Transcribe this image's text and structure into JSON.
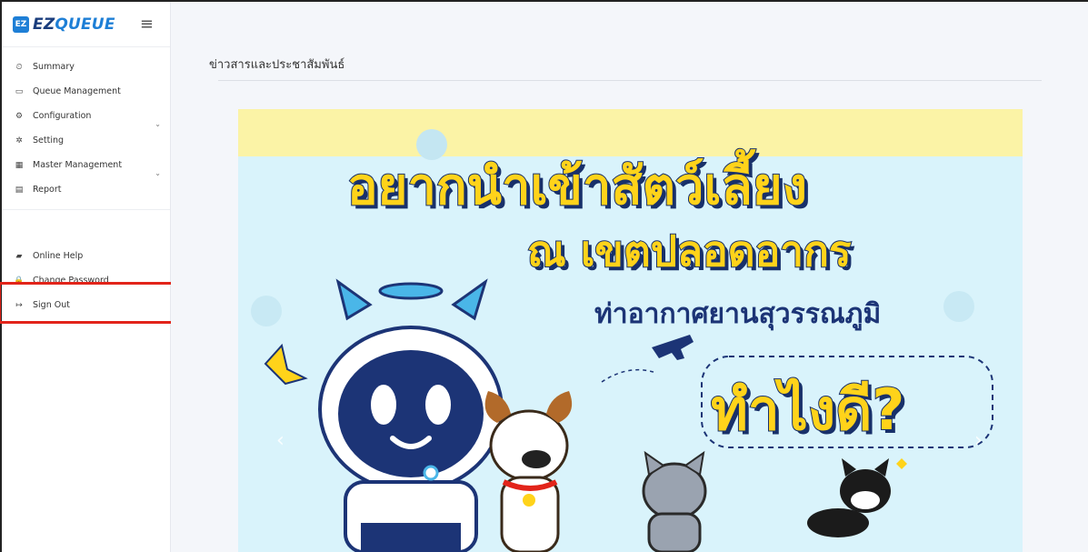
{
  "brand": {
    "logo": "EZ",
    "name_part1": "EZ",
    "name_part2": "QUEUE"
  },
  "sidebar": {
    "items": [
      {
        "label": "Summary",
        "icon": "dashboard-icon",
        "glyph": "⏲"
      },
      {
        "label": "Queue Management",
        "icon": "inbox-icon",
        "glyph": "▭"
      },
      {
        "label": "Configuration",
        "icon": "gears-icon",
        "glyph": "⚙",
        "has_submenu": true
      },
      {
        "label": "Setting",
        "icon": "gear-icon",
        "glyph": "✲"
      },
      {
        "label": "Master Management",
        "icon": "table-icon",
        "glyph": "▦",
        "has_submenu": true
      },
      {
        "label": "Report",
        "icon": "file-icon",
        "glyph": "▤"
      }
    ],
    "bottom_items": [
      {
        "label": "Online Help",
        "icon": "book-icon",
        "glyph": "▰"
      },
      {
        "label": "Change Password",
        "icon": "lock-icon",
        "glyph": "🔒"
      },
      {
        "label": "Sign Out",
        "icon": "sign-out-icon",
        "glyph": "↦"
      }
    ]
  },
  "main": {
    "page_title": "ข่าวสารและประชาสัมพันธ์",
    "banner": {
      "line1": "อยากนำเข้าสัตว์เลี้ยง",
      "line2": "ณ เขตปลอดอากร",
      "line3": "ท่าอากาศยานสุวรรณภูมิ",
      "line4": "ทำไงดี?"
    }
  },
  "colors": {
    "accent": "#1e7fd6",
    "brand_dark": "#1a3d7c",
    "highlight": "#e2241a",
    "banner_yellow": "#ffd31a",
    "banner_navy": "#18306a"
  }
}
